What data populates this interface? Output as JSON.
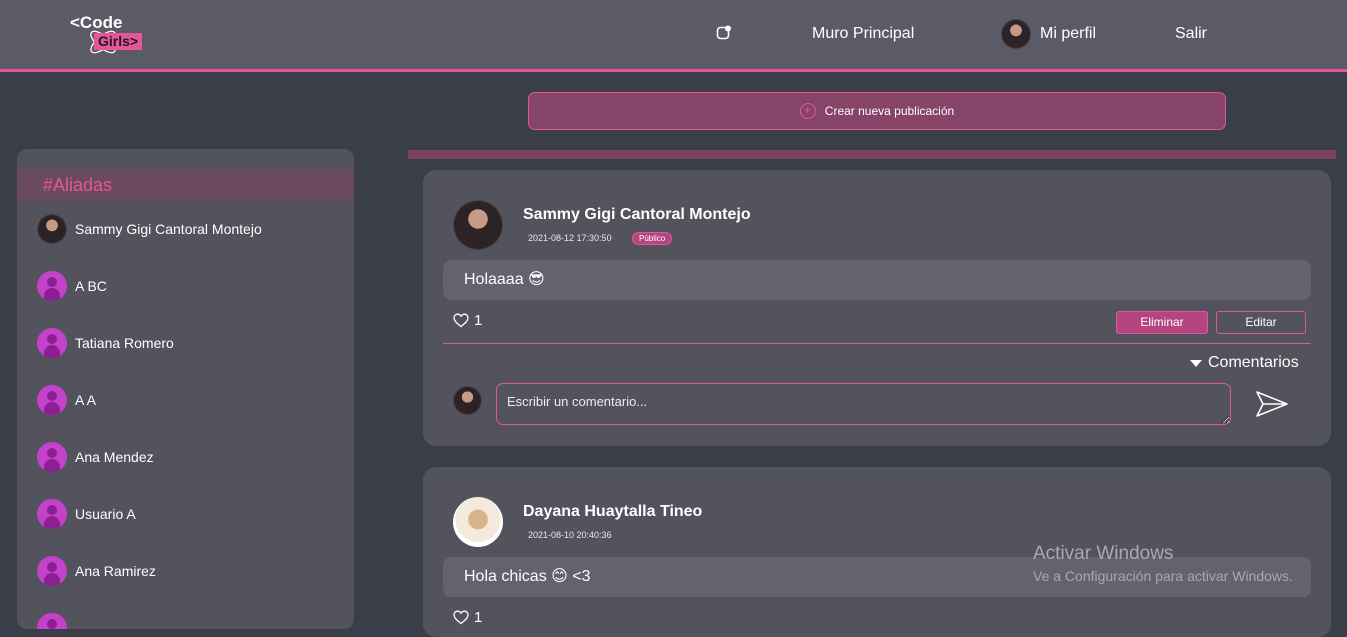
{
  "header": {
    "logo": {
      "line1": "<Code",
      "line2": "Girls>"
    },
    "nav": {
      "muro": "Muro Principal",
      "perfil": "Mi perfil",
      "salir": "Salir"
    }
  },
  "create_post": {
    "label": "Crear nueva publicación"
  },
  "sidebar": {
    "title": "#Aliadas",
    "items": [
      {
        "name": "Sammy Gigi Cantoral Montejo"
      },
      {
        "name": "A BC"
      },
      {
        "name": "Tatiana Romero"
      },
      {
        "name": "A A"
      },
      {
        "name": "Ana Mendez"
      },
      {
        "name": "Usuario A"
      },
      {
        "name": "Ana Ramirez"
      }
    ]
  },
  "posts": [
    {
      "author": "Sammy Gigi Cantoral Montejo",
      "date": "2021-08-12 17:30:50",
      "visibility": "Público",
      "body": "Holaaaa 😎",
      "likes": "1",
      "delete_label": "Eliminar",
      "edit_label": "Editar",
      "comments_label": "Comentarios",
      "comment_placeholder": "Escribir un comentario..."
    },
    {
      "author": "Dayana Huaytalla Tineo",
      "date": "2021-08-10 20:40:36",
      "body": "Hola chicas 😊 <3",
      "likes": "1"
    }
  ],
  "watermark": {
    "title": "Activar Windows",
    "subtitle": "Ve a Configuración para activar Windows."
  },
  "colors": {
    "accent": "#e6559a",
    "header_bg": "#5a5b66",
    "page_bg": "#3a3e48",
    "card_bg": "#52535d"
  }
}
